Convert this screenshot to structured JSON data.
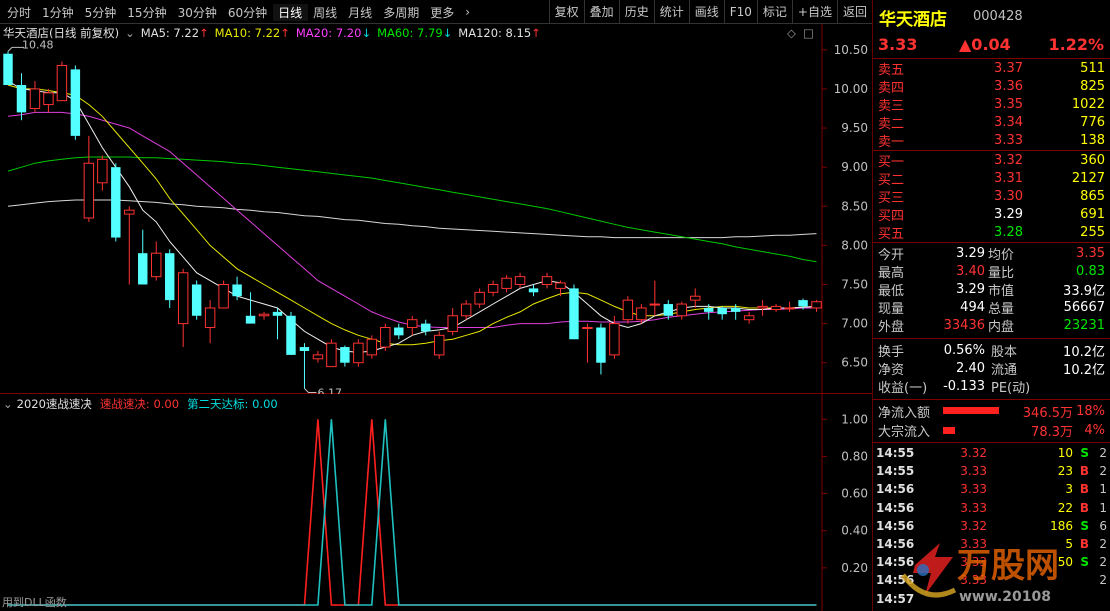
{
  "toolbar": {
    "periods": [
      "分时",
      "1分钟",
      "5分钟",
      "15分钟",
      "30分钟",
      "60分钟",
      "日线",
      "周线",
      "月线",
      "多周期",
      "更多"
    ],
    "active_period": "日线",
    "more_chevron": "›",
    "actions": [
      "复权",
      "叠加",
      "历史",
      "统计",
      "画线",
      "F10",
      "标记",
      "+自选",
      "返回"
    ]
  },
  "main": {
    "title": "华天酒店(日线 前复权)",
    "ma_labels": [
      {
        "text": "MA5: 7.22",
        "dir": "↑"
      },
      {
        "text": "MA10: 7.22",
        "dir": "↑"
      },
      {
        "text": "MA20: 7.20",
        "dir": "↓"
      },
      {
        "text": "MA60: 7.79",
        "dir": "↓"
      },
      {
        "text": "MA120: 8.15",
        "dir": "↑"
      }
    ],
    "high_label": "10.48",
    "low_label": "6.17",
    "y_ticks": [
      "10.50",
      "10.00",
      "9.50",
      "9.00",
      "8.50",
      "8.00",
      "7.50",
      "7.00",
      "6.50"
    ]
  },
  "sub": {
    "name": "2020速战速决",
    "line1": "速战速决: 0.00",
    "line2": "第二天达标: 0.00",
    "y_ticks": [
      "1.00",
      "0.80",
      "0.60",
      "0.40",
      "0.20"
    ],
    "footnote": "用到DLL函数"
  },
  "chart_data": {
    "type": "candlestick",
    "ylim": [
      6.1,
      10.6
    ],
    "candles": [
      [
        10.45,
        10.05,
        10.48,
        10.05
      ],
      [
        10.05,
        9.7,
        10.2,
        9.6
      ],
      [
        9.75,
        10.0,
        10.1,
        9.7
      ],
      [
        9.8,
        9.95,
        10.0,
        9.7
      ],
      [
        9.85,
        10.3,
        10.35,
        9.85
      ],
      [
        10.25,
        9.4,
        10.3,
        9.35
      ],
      [
        8.35,
        9.05,
        9.4,
        8.3
      ],
      [
        8.8,
        9.1,
        9.15,
        8.7
      ],
      [
        9.0,
        8.1,
        9.05,
        8.05
      ],
      [
        8.4,
        8.45,
        8.5,
        7.5
      ],
      [
        7.9,
        7.5,
        8.2,
        7.5
      ],
      [
        7.6,
        7.9,
        8.05,
        7.55
      ],
      [
        7.9,
        7.3,
        7.95,
        7.2
      ],
      [
        7.0,
        7.65,
        7.7,
        6.7
      ],
      [
        7.5,
        7.1,
        7.55,
        7.05
      ],
      [
        6.95,
        7.2,
        7.3,
        6.75
      ],
      [
        7.2,
        7.5,
        7.55,
        7.2
      ],
      [
        7.5,
        7.35,
        7.6,
        7.3
      ],
      [
        7.1,
        7.0,
        7.4,
        7.0
      ],
      [
        7.1,
        7.12,
        7.15,
        7.05
      ],
      [
        7.15,
        7.1,
        7.2,
        6.8
      ],
      [
        7.1,
        6.6,
        7.15,
        6.6
      ],
      [
        6.7,
        6.65,
        6.75,
        6.17
      ],
      [
        6.55,
        6.6,
        6.65,
        6.5
      ],
      [
        6.45,
        6.75,
        6.8,
        6.45
      ],
      [
        6.7,
        6.5,
        6.72,
        6.45
      ],
      [
        6.5,
        6.75,
        6.8,
        6.45
      ],
      [
        6.6,
        6.8,
        6.85,
        6.55
      ],
      [
        6.7,
        6.95,
        7.0,
        6.65
      ],
      [
        6.95,
        6.85,
        7.0,
        6.8
      ],
      [
        6.95,
        7.05,
        7.1,
        6.85
      ],
      [
        7.0,
        6.9,
        7.05,
        6.85
      ],
      [
        6.6,
        6.85,
        6.9,
        6.55
      ],
      [
        6.9,
        7.1,
        7.2,
        6.85
      ],
      [
        7.1,
        7.25,
        7.3,
        7.05
      ],
      [
        7.25,
        7.4,
        7.45,
        7.2
      ],
      [
        7.4,
        7.5,
        7.55,
        7.35
      ],
      [
        7.45,
        7.58,
        7.62,
        7.4
      ],
      [
        7.5,
        7.6,
        7.65,
        7.45
      ],
      [
        7.45,
        7.4,
        7.5,
        7.35
      ],
      [
        7.5,
        7.6,
        7.65,
        7.45
      ],
      [
        7.45,
        7.52,
        7.55,
        7.35
      ],
      [
        7.45,
        6.8,
        7.5,
        6.8
      ],
      [
        6.95,
        6.95,
        7.0,
        6.5
      ],
      [
        6.95,
        6.5,
        7.0,
        6.35
      ],
      [
        6.6,
        7.0,
        7.1,
        6.55
      ],
      [
        7.05,
        7.3,
        7.35,
        7.0
      ],
      [
        7.05,
        7.2,
        7.25,
        7.0
      ],
      [
        7.25,
        7.25,
        7.55,
        7.1
      ],
      [
        7.25,
        7.1,
        7.3,
        7.05
      ],
      [
        7.1,
        7.25,
        7.28,
        7.05
      ],
      [
        7.3,
        7.35,
        7.45,
        7.2
      ],
      [
        7.2,
        7.15,
        7.25,
        7.05
      ],
      [
        7.2,
        7.12,
        7.22,
        7.05
      ],
      [
        7.2,
        7.15,
        7.25,
        7.05
      ],
      [
        7.05,
        7.1,
        7.15,
        7.0
      ],
      [
        7.2,
        7.22,
        7.3,
        7.1
      ],
      [
        7.18,
        7.22,
        7.25,
        7.15
      ],
      [
        7.2,
        7.2,
        7.28,
        7.15
      ],
      [
        7.3,
        7.22,
        7.32,
        7.18
      ],
      [
        7.2,
        7.28,
        7.3,
        7.15
      ]
    ],
    "ma5": [
      10.1,
      10.0,
      9.98,
      9.95,
      9.95,
      9.85,
      9.55,
      9.25,
      9.0,
      8.75,
      8.45,
      8.3,
      8.05,
      7.85,
      7.65,
      7.55,
      7.45,
      7.35,
      7.3,
      7.25,
      7.2,
      7.05,
      6.9,
      6.8,
      6.7,
      6.65,
      6.63,
      6.65,
      6.7,
      6.75,
      6.85,
      6.9,
      6.92,
      6.95,
      7.05,
      7.15,
      7.25,
      7.35,
      7.45,
      7.5,
      7.55,
      7.52,
      7.4,
      7.25,
      7.1,
      7.0,
      6.95,
      7.0,
      7.1,
      7.15,
      7.2,
      7.22,
      7.22,
      7.2,
      7.2,
      7.18,
      7.18,
      7.2,
      7.2,
      7.21,
      7.22
    ],
    "ma10": [
      10.05,
      10.0,
      10.0,
      9.98,
      9.95,
      9.92,
      9.8,
      9.65,
      9.45,
      9.25,
      9.05,
      8.85,
      8.6,
      8.4,
      8.2,
      8.0,
      7.85,
      7.7,
      7.6,
      7.5,
      7.4,
      7.3,
      7.2,
      7.1,
      7.0,
      6.92,
      6.85,
      6.8,
      6.75,
      6.73,
      6.73,
      6.75,
      6.78,
      6.8,
      6.85,
      6.9,
      7.0,
      7.08,
      7.15,
      7.25,
      7.32,
      7.38,
      7.4,
      7.38,
      7.3,
      7.22,
      7.15,
      7.1,
      7.1,
      7.12,
      7.15,
      7.18,
      7.2,
      7.22,
      7.22,
      7.2,
      7.2,
      7.2,
      7.2,
      7.21,
      7.22
    ],
    "ma20": [
      9.65,
      9.67,
      9.7,
      9.7,
      9.7,
      9.68,
      9.65,
      9.6,
      9.55,
      9.5,
      9.4,
      9.3,
      9.2,
      9.05,
      8.9,
      8.75,
      8.6,
      8.45,
      8.3,
      8.15,
      8.0,
      7.85,
      7.7,
      7.55,
      7.45,
      7.35,
      7.25,
      7.15,
      7.08,
      7.02,
      6.98,
      6.96,
      6.95,
      6.95,
      6.95,
      6.95,
      6.95,
      6.98,
      7.0,
      7.0,
      7.0,
      7.02,
      7.03,
      7.03,
      7.02,
      7.02,
      7.02,
      7.03,
      7.05,
      7.08,
      7.1,
      7.12,
      7.14,
      7.15,
      7.16,
      7.17,
      7.18,
      7.18,
      7.19,
      7.2,
      7.2
    ],
    "ma60": [
      8.95,
      9.0,
      9.05,
      9.08,
      9.1,
      9.12,
      9.13,
      9.13,
      9.13,
      9.13,
      9.12,
      9.12,
      9.11,
      9.1,
      9.09,
      9.08,
      9.07,
      9.05,
      9.04,
      9.02,
      9.0,
      8.98,
      8.96,
      8.94,
      8.92,
      8.9,
      8.88,
      8.86,
      8.83,
      8.8,
      8.77,
      8.74,
      8.71,
      8.68,
      8.65,
      8.62,
      8.59,
      8.56,
      8.53,
      8.5,
      8.47,
      8.43,
      8.39,
      8.35,
      8.31,
      8.27,
      8.23,
      8.2,
      8.17,
      8.14,
      8.11,
      8.08,
      8.05,
      8.02,
      7.98,
      7.95,
      7.92,
      7.89,
      7.86,
      7.82,
      7.79
    ],
    "ma120": [
      8.5,
      8.52,
      8.54,
      8.56,
      8.57,
      8.58,
      8.58,
      8.58,
      8.58,
      8.57,
      8.56,
      8.55,
      8.53,
      8.52,
      8.5,
      8.49,
      8.48,
      8.46,
      8.45,
      8.43,
      8.42,
      8.4,
      8.38,
      8.37,
      8.35,
      8.33,
      8.32,
      8.3,
      8.28,
      8.27,
      8.25,
      8.24,
      8.22,
      8.21,
      8.2,
      8.19,
      8.18,
      8.17,
      8.16,
      8.15,
      8.14,
      8.13,
      8.12,
      8.11,
      8.11,
      8.1,
      8.1,
      8.1,
      8.1,
      8.1,
      8.1,
      8.1,
      8.1,
      8.1,
      8.11,
      8.11,
      8.12,
      8.13,
      8.13,
      8.14,
      8.15
    ],
    "signals": {
      "ylim": [
        0,
        1.05
      ],
      "series": [
        {
          "name": "速战速决",
          "color": "#ff2020",
          "spikes": [
            23,
            27
          ]
        },
        {
          "name": "第二天达标",
          "color": "#20c0c0",
          "spikes": [
            24,
            28
          ]
        }
      ]
    }
  },
  "panel": {
    "name": "华天酒店",
    "code": "000428",
    "price": "3.33",
    "change": "▲0.04",
    "pct": "1.22%",
    "asks": [
      {
        "label": "卖五",
        "price": "3.37",
        "vol": "511"
      },
      {
        "label": "卖四",
        "price": "3.36",
        "vol": "825"
      },
      {
        "label": "卖三",
        "price": "3.35",
        "vol": "1022"
      },
      {
        "label": "卖二",
        "price": "3.34",
        "vol": "776"
      },
      {
        "label": "卖一",
        "price": "3.33",
        "vol": "138"
      }
    ],
    "bids": [
      {
        "label": "买一",
        "price": "3.32",
        "vol": "360"
      },
      {
        "label": "买二",
        "price": "3.31",
        "vol": "2127"
      },
      {
        "label": "买三",
        "price": "3.30",
        "vol": "865"
      },
      {
        "label": "买四",
        "price": "3.29",
        "vol": "691"
      },
      {
        "label": "买五",
        "price": "3.28",
        "vol": "255"
      }
    ],
    "stats": [
      {
        "l1": "今开",
        "v1": "3.29",
        "c1": "wht",
        "l2": "均价",
        "v2": "3.35",
        "c2": "red"
      },
      {
        "l1": "最高",
        "v1": "3.40",
        "c1": "red",
        "l2": "量比",
        "v2": "0.83",
        "c2": "grn"
      },
      {
        "l1": "最低",
        "v1": "3.29",
        "c1": "wht",
        "l2": "市值",
        "v2": "33.9亿",
        "c2": "wht"
      },
      {
        "l1": "现量",
        "v1": "494",
        "c1": "wht",
        "l2": "总量",
        "v2": "56667",
        "c2": "wht"
      },
      {
        "l1": "外盘",
        "v1": "33436",
        "c1": "red",
        "l2": "内盘",
        "v2": "23231",
        "c2": "grn"
      }
    ],
    "stats2": [
      {
        "l1": "换手",
        "v1": "0.56%",
        "l2": "股本",
        "v2": "10.2亿"
      },
      {
        "l1": "净资",
        "v1": "2.40",
        "l2": "流通",
        "v2": "10.2亿"
      },
      {
        "l1": "收益(一)",
        "v1": "-0.133",
        "l2": "PE(动)",
        "v2": ""
      }
    ],
    "flows": [
      {
        "label": "净流入额",
        "value": "346.5万",
        "pct": "18%",
        "bar": 0.18
      },
      {
        "label": "大宗流入",
        "value": "78.3万",
        "pct": "4%",
        "bar": 0.04
      }
    ],
    "trades": [
      {
        "time": "14:55",
        "price": "3.32",
        "pc": "red",
        "vol": "10",
        "side": "S",
        "sc": "grn",
        "cnt": "2"
      },
      {
        "time": "14:55",
        "price": "3.33",
        "pc": "red",
        "vol": "23",
        "side": "B",
        "sc": "red",
        "cnt": "2"
      },
      {
        "time": "14:56",
        "price": "3.33",
        "pc": "red",
        "vol": "3",
        "side": "B",
        "sc": "red",
        "cnt": "1"
      },
      {
        "time": "14:56",
        "price": "3.33",
        "pc": "red",
        "vol": "22",
        "side": "B",
        "sc": "red",
        "cnt": "1"
      },
      {
        "time": "14:56",
        "price": "3.32",
        "pc": "red",
        "vol": "186",
        "side": "S",
        "sc": "grn",
        "cnt": "6"
      },
      {
        "time": "14:56",
        "price": "3.33",
        "pc": "red",
        "vol": "5",
        "side": "B",
        "sc": "red",
        "cnt": "2"
      },
      {
        "time": "14:56",
        "price": "3.33",
        "pc": "red",
        "vol": "50",
        "side": "S",
        "sc": "grn",
        "cnt": "2"
      },
      {
        "time": "14:56",
        "price": "3.33",
        "pc": "red",
        "vol": "",
        "side": "",
        "sc": "red",
        "cnt": "2"
      },
      {
        "time": "14:57",
        "price": "",
        "pc": "red",
        "vol": "",
        "side": "",
        "sc": "red",
        "cnt": ""
      }
    ],
    "watermark": {
      "brand": "万股网",
      "url": "www.20108"
    }
  }
}
